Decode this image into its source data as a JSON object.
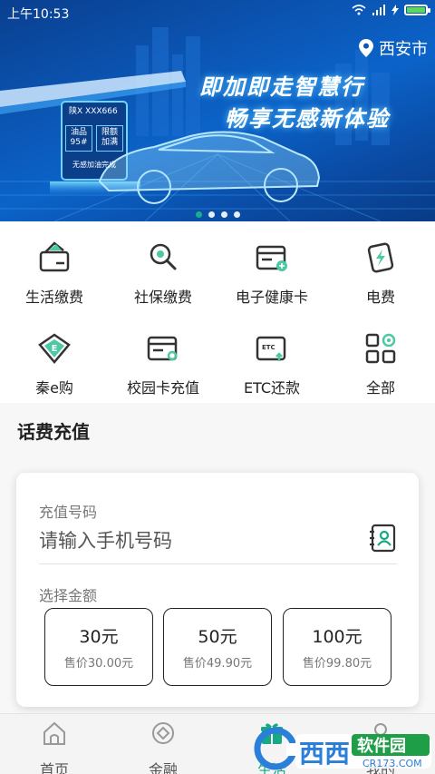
{
  "status_bar": {
    "time": "上午10:53"
  },
  "banner": {
    "location": "西安市",
    "headline_1": "即加即走智慧行",
    "headline_2": "畅享无感新体验",
    "plate": "陕X XXX666",
    "fuel": "油品",
    "fuel_grade": "95#",
    "limit": "限额",
    "limit_value": "加满",
    "panel_footer": "无感加油完成",
    "page_count": 4,
    "active_page": 1
  },
  "services": [
    {
      "label": "生活缴费",
      "icon": "wallet-card-icon"
    },
    {
      "label": "社保缴费",
      "icon": "magnifier-icon"
    },
    {
      "label": "电子健康卡",
      "icon": "health-card-icon"
    },
    {
      "label": "电费",
      "icon": "lightning-card-icon"
    },
    {
      "label": "秦e购",
      "icon": "diamond-e-icon"
    },
    {
      "label": "校园卡充值",
      "icon": "campus-card-icon"
    },
    {
      "label": "ETC还款",
      "icon": "etc-card-icon"
    },
    {
      "label": "全部",
      "icon": "all-apps-icon"
    }
  ],
  "topup": {
    "section_title": "话费充值",
    "phone_label": "充值号码",
    "phone_placeholder": "请输入手机号码",
    "amount_label": "选择金额",
    "options": [
      {
        "value": "30元",
        "price": "售价30.00元"
      },
      {
        "value": "50元",
        "price": "售价49.90元"
      },
      {
        "value": "100元",
        "price": "售价99.80元"
      }
    ]
  },
  "bottom_nav": {
    "tabs": [
      {
        "label": "首页",
        "icon": "home-icon"
      },
      {
        "label": "金融",
        "icon": "finance-icon"
      },
      {
        "label": "生活",
        "icon": "gift-icon"
      },
      {
        "label": "我的",
        "icon": "profile-icon"
      }
    ],
    "active": "生活"
  },
  "watermark": {
    "brand": "西西",
    "tag": "软件园",
    "domain": "CR173.COM"
  },
  "colors": {
    "accent": "#17a884",
    "banner_blue": "#0b56b5",
    "text": "#222222"
  }
}
